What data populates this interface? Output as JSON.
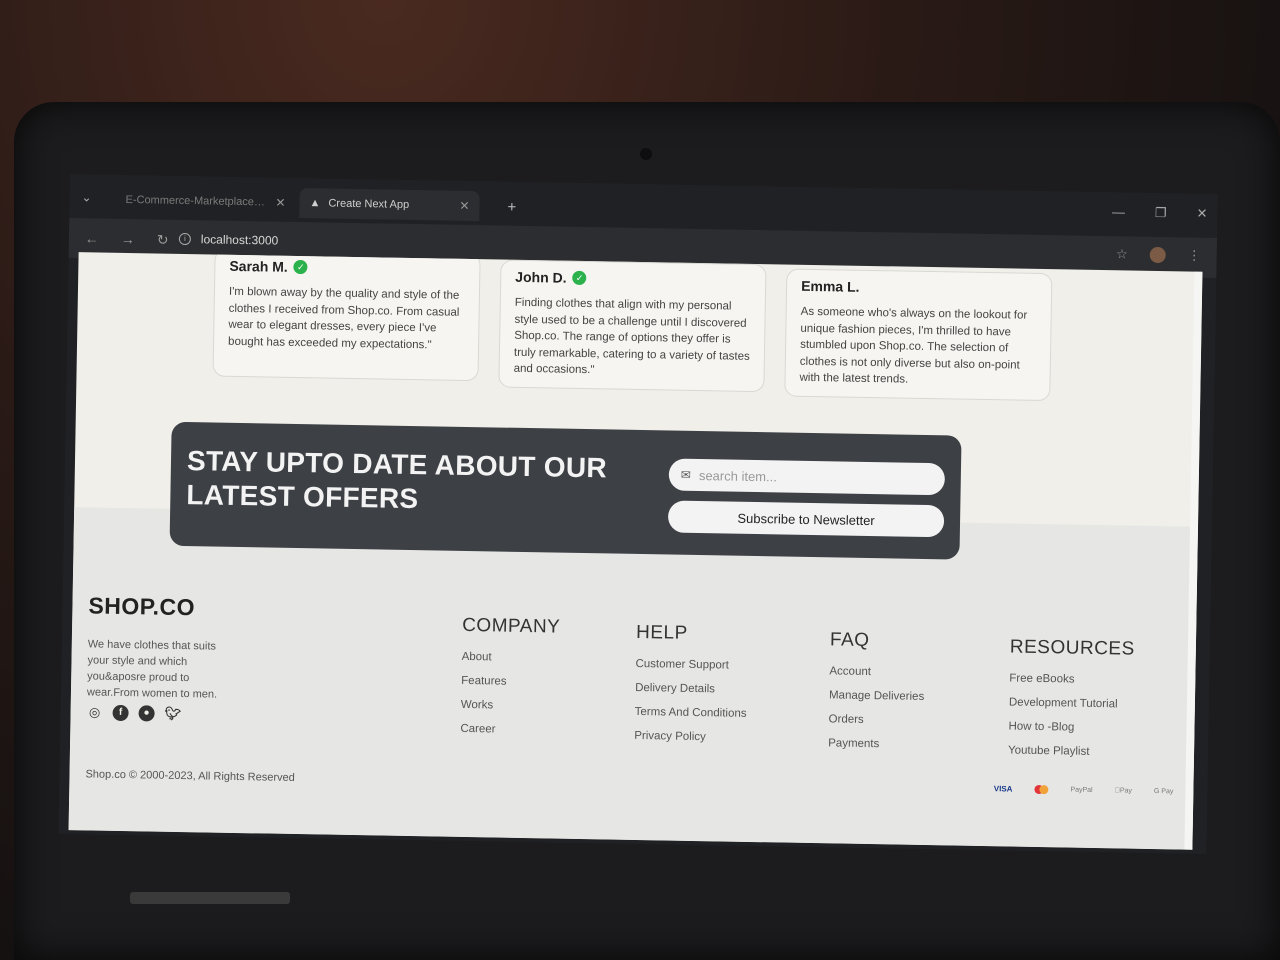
{
  "browser": {
    "tabs": [
      {
        "title": "E-Commerce-Marketplace/dc",
        "active": false
      },
      {
        "title": "Create Next App",
        "active": true
      }
    ],
    "new_tab": "+",
    "url": "localhost:3000"
  },
  "reviews": [
    {
      "name": "Sarah M.",
      "text": "I'm blown away by the quality and style of the clothes I received from Shop.co. From casual wear to elegant dresses, every piece I've bought has exceeded my expectations.\""
    },
    {
      "name": "John D.",
      "text": "Finding clothes that align with my personal style used to be a challenge until I discovered Shop.co. The range of options they offer is truly remarkable, catering to a variety of tastes and occasions.\""
    },
    {
      "name": "Emma L.",
      "text": "As someone who's always on the lookout for unique fashion pieces, I'm thrilled to have stumbled upon Shop.co. The selection of clothes is not only diverse but also on-point with the latest trends."
    }
  ],
  "newsletter": {
    "title": "STAY UPTO DATE ABOUT OUR LATEST OFFERS",
    "placeholder": "search item...",
    "button": "Subscribe to Newsletter"
  },
  "footer": {
    "brand": "SHOP.CO",
    "description": "We have clothes that suits your style and which you&aposre proud to wear.From women to men.",
    "socials": [
      "instagram-icon",
      "facebook-icon",
      "github-icon",
      "twitter-icon"
    ],
    "columns": [
      {
        "title": "COMPANY",
        "links": [
          "About",
          "Features",
          "Works",
          "Career"
        ]
      },
      {
        "title": "HELP",
        "links": [
          "Customer Support",
          "Delivery Details",
          "Terms And Conditions",
          "Privacy Policy"
        ]
      },
      {
        "title": "FAQ",
        "links": [
          "Account",
          "Manage Deliveries",
          "Orders",
          "Payments"
        ]
      },
      {
        "title": "RESOURCES",
        "links": [
          "Free eBooks",
          "Development Tutorial",
          "How to -Blog",
          "Youtube Playlist"
        ]
      }
    ],
    "copyright": "Shop.co © 2000-2023, All Rights Reserved",
    "payments": [
      "VISA",
      "mastercard",
      "PayPal",
      "Pay",
      "G Pay"
    ]
  },
  "colors": {
    "newsletter_bg": "#3d4045",
    "page_bg": "#f0efe9",
    "verified": "#2bb24c"
  }
}
